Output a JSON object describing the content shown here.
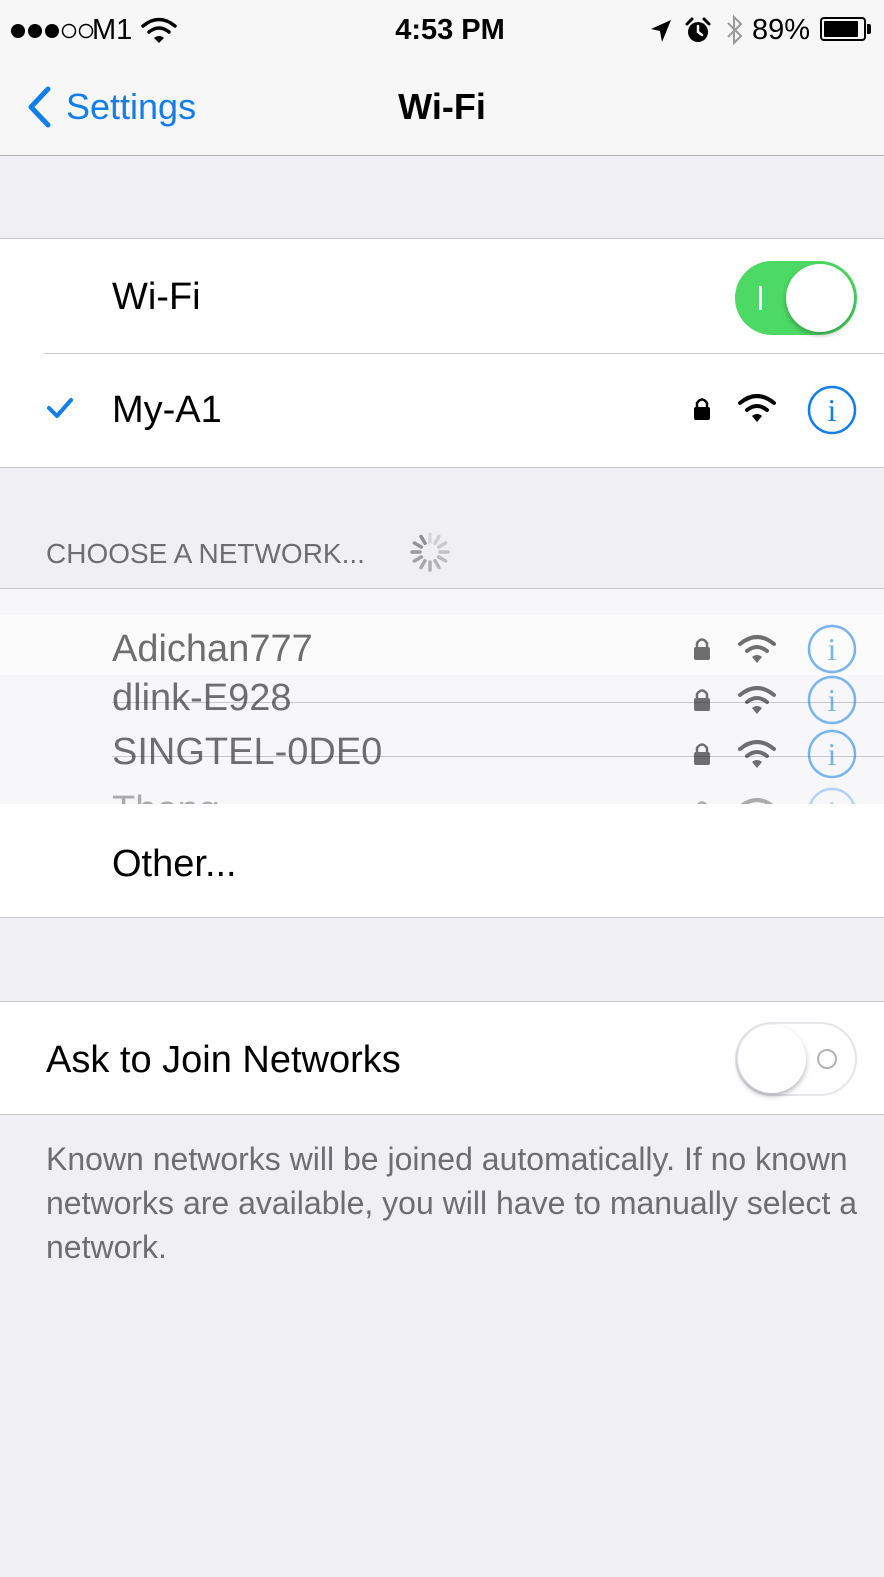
{
  "status_bar": {
    "carrier": "M1",
    "time": "4:53 PM",
    "battery": "89%",
    "signal_bars_filled": 3,
    "signal_bars_total": 5
  },
  "nav": {
    "back_label": "Settings",
    "title": "Wi-Fi"
  },
  "wifi": {
    "label": "Wi-Fi",
    "enabled": true
  },
  "connected": {
    "name": "My-A1"
  },
  "choose_header": "CHOOSE A NETWORK...",
  "networks": [
    {
      "name": "Adichan777"
    },
    {
      "name": "dlink-E928"
    },
    {
      "name": "SINGTEL-0DE0"
    },
    {
      "name": "Thong"
    }
  ],
  "other_label": "Other...",
  "ask_to_join": {
    "label": "Ask to Join Networks",
    "enabled": false
  },
  "footer": "Known networks will be joined automatically. If no known networks are available, you will have to manually select a network.",
  "colors": {
    "accent": "#127ee8",
    "toggle_on": "#4cd964",
    "background": "#efeff4"
  }
}
